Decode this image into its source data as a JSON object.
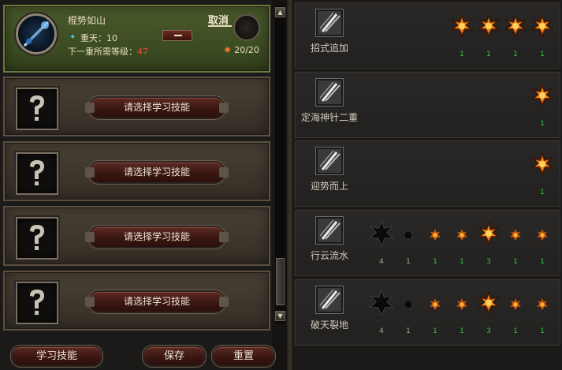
{
  "active_skill": {
    "name": "棍势如山",
    "cancel_label": "取消",
    "tier_label": "重天：10",
    "req_label": "下一重所需等级：",
    "req_level": "47",
    "points": "20/20"
  },
  "slots": [
    {
      "button_label": "请选择学习技能"
    },
    {
      "button_label": "请选择学习技能"
    },
    {
      "button_label": "请选择学习技能"
    },
    {
      "button_label": "请选择学习技能"
    }
  ],
  "bottom": {
    "learn_label": "学习技能",
    "save_label": "保存",
    "reset_label": "重置"
  },
  "talents": [
    {
      "name": "招式追加",
      "nodes": [
        {
          "kind": "star",
          "level": "1",
          "color": "green"
        },
        {
          "kind": "star",
          "level": "1",
          "color": "green"
        },
        {
          "kind": "star",
          "level": "1",
          "color": "green"
        },
        {
          "kind": "star",
          "level": "1",
          "color": "green"
        }
      ]
    },
    {
      "name": "定海神针二重",
      "nodes": [
        {
          "kind": "star",
          "level": "1",
          "color": "green"
        }
      ]
    },
    {
      "name": "迎势而上",
      "nodes": [
        {
          "kind": "star",
          "level": "1",
          "color": "green"
        }
      ]
    },
    {
      "name": "行云流水",
      "nodes": [
        {
          "kind": "dark-big",
          "level": "4",
          "color": "white"
        },
        {
          "kind": "dark-small",
          "level": "1",
          "color": "white"
        },
        {
          "kind": "small",
          "level": "1",
          "color": "green"
        },
        {
          "kind": "small",
          "level": "1",
          "color": "green"
        },
        {
          "kind": "star",
          "level": "3",
          "color": "green"
        },
        {
          "kind": "small",
          "level": "1",
          "color": "green"
        },
        {
          "kind": "small",
          "level": "1",
          "color": "green"
        }
      ]
    },
    {
      "name": "破天裂地",
      "nodes": [
        {
          "kind": "dark-big",
          "level": "4",
          "color": "white"
        },
        {
          "kind": "dark-small",
          "level": "1",
          "color": "white"
        },
        {
          "kind": "small",
          "level": "1",
          "color": "green"
        },
        {
          "kind": "small",
          "level": "1",
          "color": "green"
        },
        {
          "kind": "star",
          "level": "3",
          "color": "green"
        },
        {
          "kind": "small",
          "level": "1",
          "color": "green"
        },
        {
          "kind": "small",
          "level": "1",
          "color": "green"
        }
      ]
    }
  ],
  "icons": {
    "skill_icon": "staff-skill-icon",
    "question_icon": "question-mark-icon",
    "talent_icon": "needle-talent-icon",
    "star_icon": "fire-star-icon",
    "points_icon": "orange-gem-icon",
    "tier_icon": "blue-gem-icon"
  },
  "colors": {
    "active_green": "#3d4d22",
    "level_green": "#3cc23c",
    "required_red": "#e04a3a",
    "button_red": "#3a1612"
  }
}
